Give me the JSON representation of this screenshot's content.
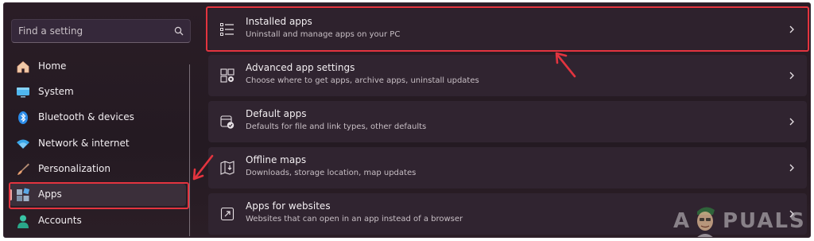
{
  "search": {
    "placeholder": "Find a setting",
    "icon": "search-icon"
  },
  "sidebar": {
    "items": [
      {
        "label": "Home",
        "icon": "home-icon"
      },
      {
        "label": "System",
        "icon": "system-display-icon"
      },
      {
        "label": "Bluetooth & devices",
        "icon": "bluetooth-icon"
      },
      {
        "label": "Network & internet",
        "icon": "wifi-icon"
      },
      {
        "label": "Personalization",
        "icon": "brush-icon"
      },
      {
        "label": "Apps",
        "icon": "apps-icon",
        "selected": true
      },
      {
        "label": "Accounts",
        "icon": "person-icon"
      }
    ]
  },
  "main": {
    "cards": [
      {
        "title": "Installed apps",
        "subtitle": "Uninstall and manage apps on your PC",
        "icon": "list-icon"
      },
      {
        "title": "Advanced app settings",
        "subtitle": "Choose where to get apps, archive apps, uninstall updates",
        "icon": "app-settings-icon"
      },
      {
        "title": "Default apps",
        "subtitle": "Defaults for file and link types, other defaults",
        "icon": "default-apps-icon"
      },
      {
        "title": "Offline maps",
        "subtitle": "Downloads, storage location, map updates",
        "icon": "map-icon"
      },
      {
        "title": "Apps for websites",
        "subtitle": "Websites that can open in an app instead of a browser",
        "icon": "open-in-app-icon"
      }
    ]
  },
  "watermark": {
    "left": "A",
    "right": "PUALS"
  },
  "colors": {
    "highlight": "#e3343f",
    "accent": "#e9a8a5",
    "background": "#261b23"
  }
}
